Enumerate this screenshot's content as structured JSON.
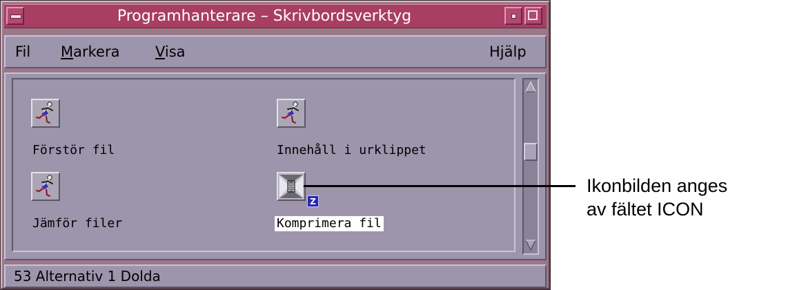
{
  "window": {
    "title": "Programhanterare – Skrivbordsverktyg"
  },
  "menubar": {
    "file_label": "Fil",
    "select_label_mnemonic": "M",
    "select_label_rest": "arkera",
    "view_label_mnemonic": "V",
    "view_label_rest": "isa",
    "help_label": "Hjälp"
  },
  "icons": [
    {
      "label": "Förstör fil",
      "icon": "runner-icon"
    },
    {
      "label": "Innehåll i urklippet",
      "icon": "runner-icon"
    },
    {
      "label": "Jämför filer",
      "icon": "runner-icon"
    },
    {
      "label": "Komprimera fil",
      "icon": "compress-icon",
      "badge": "Z",
      "selected": true
    }
  ],
  "status": {
    "text": "53 Alternativ 1 Dolda"
  },
  "annotation": {
    "line1": "Ikonbilden anges",
    "line2": "av fältet ICON"
  },
  "colors": {
    "titlebar": "#a83e62",
    "panel": "#9c95ac",
    "frame": "#9a7888",
    "badge": "#2828b0"
  }
}
